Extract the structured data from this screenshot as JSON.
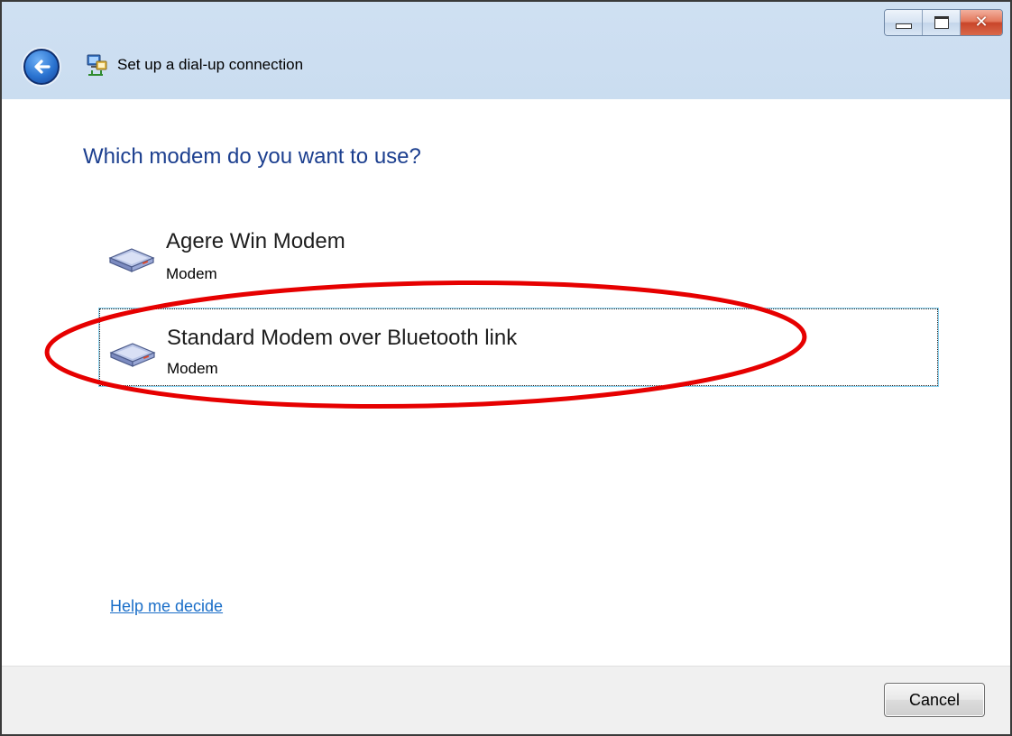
{
  "window": {
    "title": "Set up a dial-up connection",
    "controls": {
      "minimize": "minimize",
      "maximize": "maximize",
      "close": "✕"
    }
  },
  "heading": "Which modem do you want to use?",
  "modems": [
    {
      "name": "Agere Win Modem",
      "type": "Modem",
      "selected": false
    },
    {
      "name": "Standard Modem over Bluetooth link",
      "type": "Modem",
      "selected": true
    }
  ],
  "help_link": "Help me decide",
  "footer": {
    "cancel_label": "Cancel"
  },
  "colors": {
    "heading": "#1c3f8f",
    "link": "#1a6ec8",
    "annotation": "#e60000",
    "frame": "#b9d1ea"
  },
  "icons": [
    "back-arrow-icon",
    "network-connection-icon",
    "modem-icon",
    "close-icon"
  ]
}
